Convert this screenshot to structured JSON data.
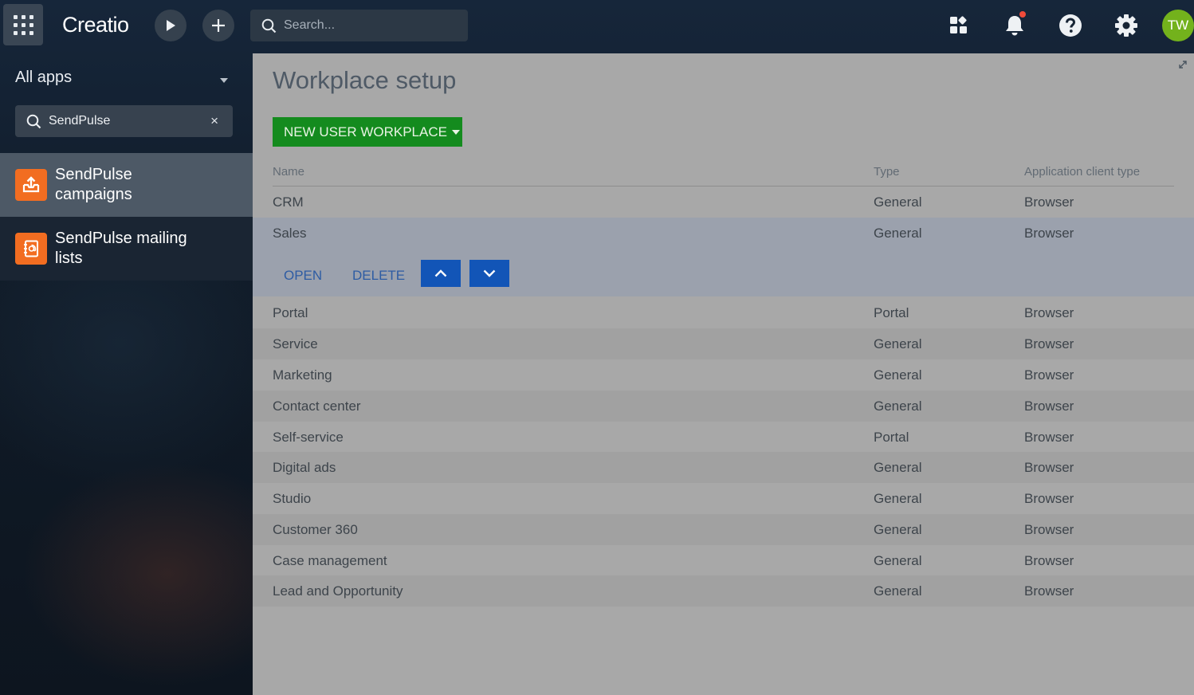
{
  "header": {
    "logo_text": "Creatio",
    "search_placeholder": "Search...",
    "avatar_initials": "TW"
  },
  "sidebar": {
    "title": "All apps",
    "search_value": "SendPulse",
    "clear_glyph": "×",
    "items": [
      {
        "label_line1": "SendPulse",
        "label_line2": "campaigns",
        "icon": "upload-tray-icon",
        "selected": true
      },
      {
        "label_line1": "SendPulse mailing",
        "label_line2": "lists",
        "icon": "address-book-icon",
        "selected": false
      }
    ]
  },
  "main": {
    "title": "Workplace setup",
    "new_button_label": "NEW USER WORKPLACE",
    "columns": [
      "Name",
      "Type",
      "Application client type"
    ],
    "row_actions": {
      "open": "OPEN",
      "delete": "DELETE"
    },
    "rows": [
      {
        "name": "CRM",
        "type": "General",
        "client": "Browser"
      },
      {
        "name": "Sales",
        "type": "General",
        "client": "Browser",
        "selected": true
      },
      {
        "name": "Portal",
        "type": "Portal",
        "client": "Browser"
      },
      {
        "name": "Service",
        "type": "General",
        "client": "Browser"
      },
      {
        "name": "Marketing",
        "type": "General",
        "client": "Browser"
      },
      {
        "name": "Contact center",
        "type": "General",
        "client": "Browser"
      },
      {
        "name": "Self-service",
        "type": "Portal",
        "client": "Browser"
      },
      {
        "name": "Digital ads",
        "type": "General",
        "client": "Browser"
      },
      {
        "name": "Studio",
        "type": "General",
        "client": "Browser"
      },
      {
        "name": "Customer 360",
        "type": "General",
        "client": "Browser"
      },
      {
        "name": "Case management",
        "type": "General",
        "client": "Browser"
      },
      {
        "name": "Lead and Opportunity",
        "type": "General",
        "client": "Browser"
      }
    ]
  },
  "colors": {
    "accent_green": "#148b1e",
    "action_blue": "#1255b7",
    "app_tile_orange": "#f26d21",
    "avatar_green": "#73b21c"
  }
}
